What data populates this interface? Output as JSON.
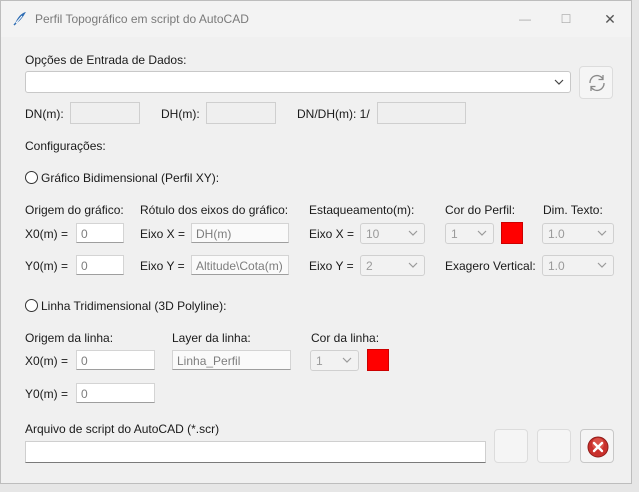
{
  "window": {
    "title": "Perfil Topográfico em script do AutoCAD",
    "minimize": "—",
    "maximize": "☐",
    "close": "✕",
    "icon": "autocad-feather-icon"
  },
  "input": {
    "label": "Opções de Entrada de Dados:",
    "combo_value": "",
    "refresh_icon": "refresh-icon"
  },
  "ratios": {
    "dn_label": "DN(m):",
    "dn_value": "",
    "dh_label": "DH(m):",
    "dh_value": "",
    "dndh_label": "DN/DH(m): 1/",
    "dndh_value": ""
  },
  "config_label": "Configurações:",
  "graph2d": {
    "radio_label": "Gráfico Bidimensional (Perfil XY):",
    "origin_label": "Origem do gráfico:",
    "x0_label": "X0(m) =",
    "x0_value": "0",
    "y0_label": "Y0(m) =",
    "y0_value": "0",
    "axis_label": "Rótulo dos eixos do gráfico:",
    "eixo_x_label": "Eixo X =",
    "eixo_x_value": "DH(m)",
    "eixo_y_label": "Eixo Y =",
    "eixo_y_value": "Altitude\\Cota(m)",
    "stake_label": "Estaqueamento(m):",
    "stake_x_label": "Eixo X =",
    "stake_x_value": "10",
    "stake_y_label": "Eixo Y =",
    "stake_y_value": "2",
    "color_label": "Cor do Perfil:",
    "color_value": "1",
    "color_swatch": "#ff0000",
    "exag_label": "Exagero Vertical:",
    "dim_label": "Dim. Texto:",
    "dim_value": "1.0",
    "exag_value": "1.0"
  },
  "line3d": {
    "radio_label": "Linha Tridimensional (3D Polyline):",
    "origin_label": "Origem da linha:",
    "x0_label": "X0(m) =",
    "x0_value": "0",
    "y0_label": "Y0(m) =",
    "y0_value": "0",
    "layer_label": "Layer da linha:",
    "layer_value": "Linha_Perfil",
    "color_label": "Cor da linha:",
    "color_value": "1",
    "color_swatch": "#ff0000"
  },
  "script": {
    "label": "Arquivo de script do AutoCAD (*.scr)",
    "path_value": "",
    "cancel_icon": "cancel-x-icon"
  }
}
